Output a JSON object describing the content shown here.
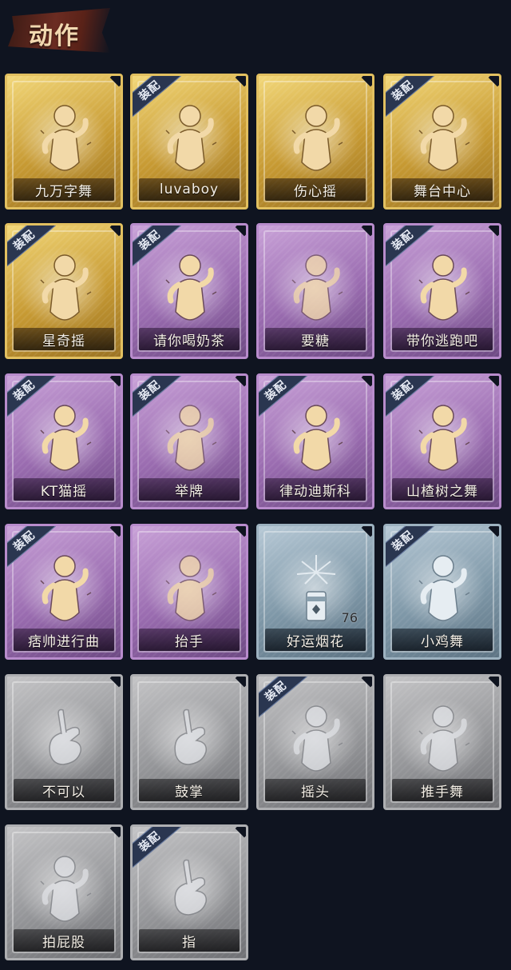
{
  "header": {
    "title": "动作"
  },
  "equipped_badge": "装配",
  "cards": [
    {
      "label": "九万字舞",
      "tier": "gold",
      "equipped": false,
      "icon": "figure-dance-icon",
      "count": ""
    },
    {
      "label": "luvaboy",
      "tier": "gold",
      "equipped": true,
      "icon": "figure-wave-icon",
      "count": ""
    },
    {
      "label": "伤心摇",
      "tier": "gold",
      "equipped": false,
      "icon": "figure-heart-icon",
      "count": ""
    },
    {
      "label": "舞台中心",
      "tier": "gold",
      "equipped": true,
      "icon": "figure-pose-icon",
      "count": ""
    },
    {
      "label": "星奇摇",
      "tier": "gold",
      "equipped": true,
      "icon": "figure-punch-icon",
      "count": ""
    },
    {
      "label": "请你喝奶茶",
      "tier": "purple",
      "equipped": true,
      "icon": "figure-sign-icon",
      "count": ""
    },
    {
      "label": "要糖",
      "tier": "purple",
      "equipped": false,
      "icon": "figure-reach-icon",
      "count": ""
    },
    {
      "label": "带你逃跑吧",
      "tier": "purple",
      "equipped": true,
      "icon": "figure-run-icon",
      "count": ""
    },
    {
      "label": "KT猫摇",
      "tier": "purple",
      "equipped": true,
      "icon": "figure-music-icon",
      "count": ""
    },
    {
      "label": "举牌",
      "tier": "purple",
      "equipped": true,
      "icon": "figure-board-icon",
      "count": ""
    },
    {
      "label": "律动迪斯科",
      "tier": "purple",
      "equipped": true,
      "icon": "figure-disco-icon",
      "count": ""
    },
    {
      "label": "山楂树之舞",
      "tier": "purple",
      "equipped": true,
      "icon": "figure-arm-up-icon",
      "count": ""
    },
    {
      "label": "痞帅进行曲",
      "tier": "purple",
      "equipped": true,
      "icon": "figure-flex-icon",
      "count": ""
    },
    {
      "label": "抬手",
      "tier": "purple",
      "equipped": false,
      "icon": "figure-raise-hand-icon",
      "count": ""
    },
    {
      "label": "好运烟花",
      "tier": "blue",
      "equipped": false,
      "icon": "firework-icon",
      "count": "76"
    },
    {
      "label": "小鸡舞",
      "tier": "blue",
      "equipped": true,
      "icon": "figure-chicken-icon",
      "count": ""
    },
    {
      "label": "不可以",
      "tier": "gray",
      "equipped": false,
      "icon": "finger-no-icon",
      "count": ""
    },
    {
      "label": "鼓掌",
      "tier": "gray",
      "equipped": false,
      "icon": "clap-icon",
      "count": ""
    },
    {
      "label": "摇头",
      "tier": "gray",
      "equipped": true,
      "icon": "figure-shake-icon",
      "count": ""
    },
    {
      "label": "推手舞",
      "tier": "gray",
      "equipped": false,
      "icon": "figure-push-icon",
      "count": ""
    },
    {
      "label": "拍屁股",
      "tier": "gray",
      "equipped": false,
      "icon": "figure-slap-icon",
      "count": ""
    },
    {
      "label": "指",
      "tier": "gray",
      "equipped": true,
      "icon": "pointing-hand-icon",
      "count": ""
    }
  ]
}
